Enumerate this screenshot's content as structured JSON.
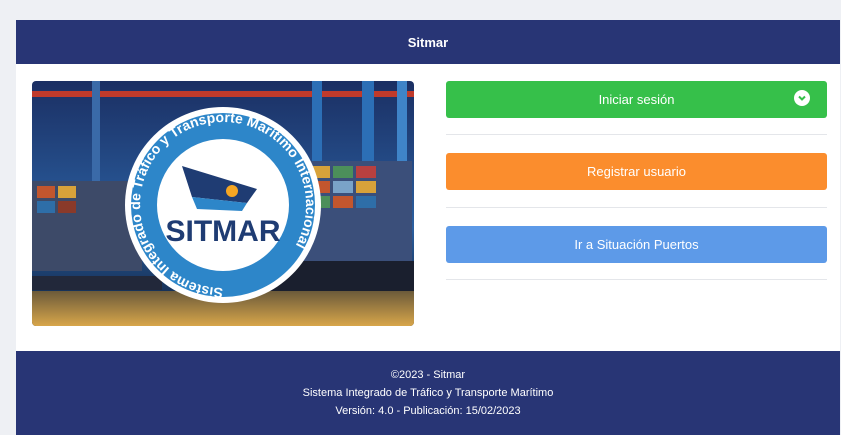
{
  "header": {
    "title": "Sitmar"
  },
  "hero": {
    "logo_wordmark": "SITMAR",
    "logo_ring_text": "Sistema Integrado de Tráfico y Transporte Marítimo Internacional"
  },
  "actions": {
    "login_label": "Iniciar sesión",
    "register_label": "Registrar usuario",
    "ports_label": "Ir a Situación Puertos"
  },
  "footer": {
    "copyright": "©2023 - Sitmar",
    "system_name": "Sistema Integrado de Tráfico y Transporte Marítimo",
    "version": "Versión: 4.0 - Publicación: 15/02/2023"
  },
  "colors": {
    "navy": "#283575",
    "login_green": "#36c04a",
    "register_orange": "#fb8d2d",
    "ports_blue": "#5d9ae8"
  },
  "icons": {
    "login_button_icon": "chevron-down-circle-icon"
  }
}
